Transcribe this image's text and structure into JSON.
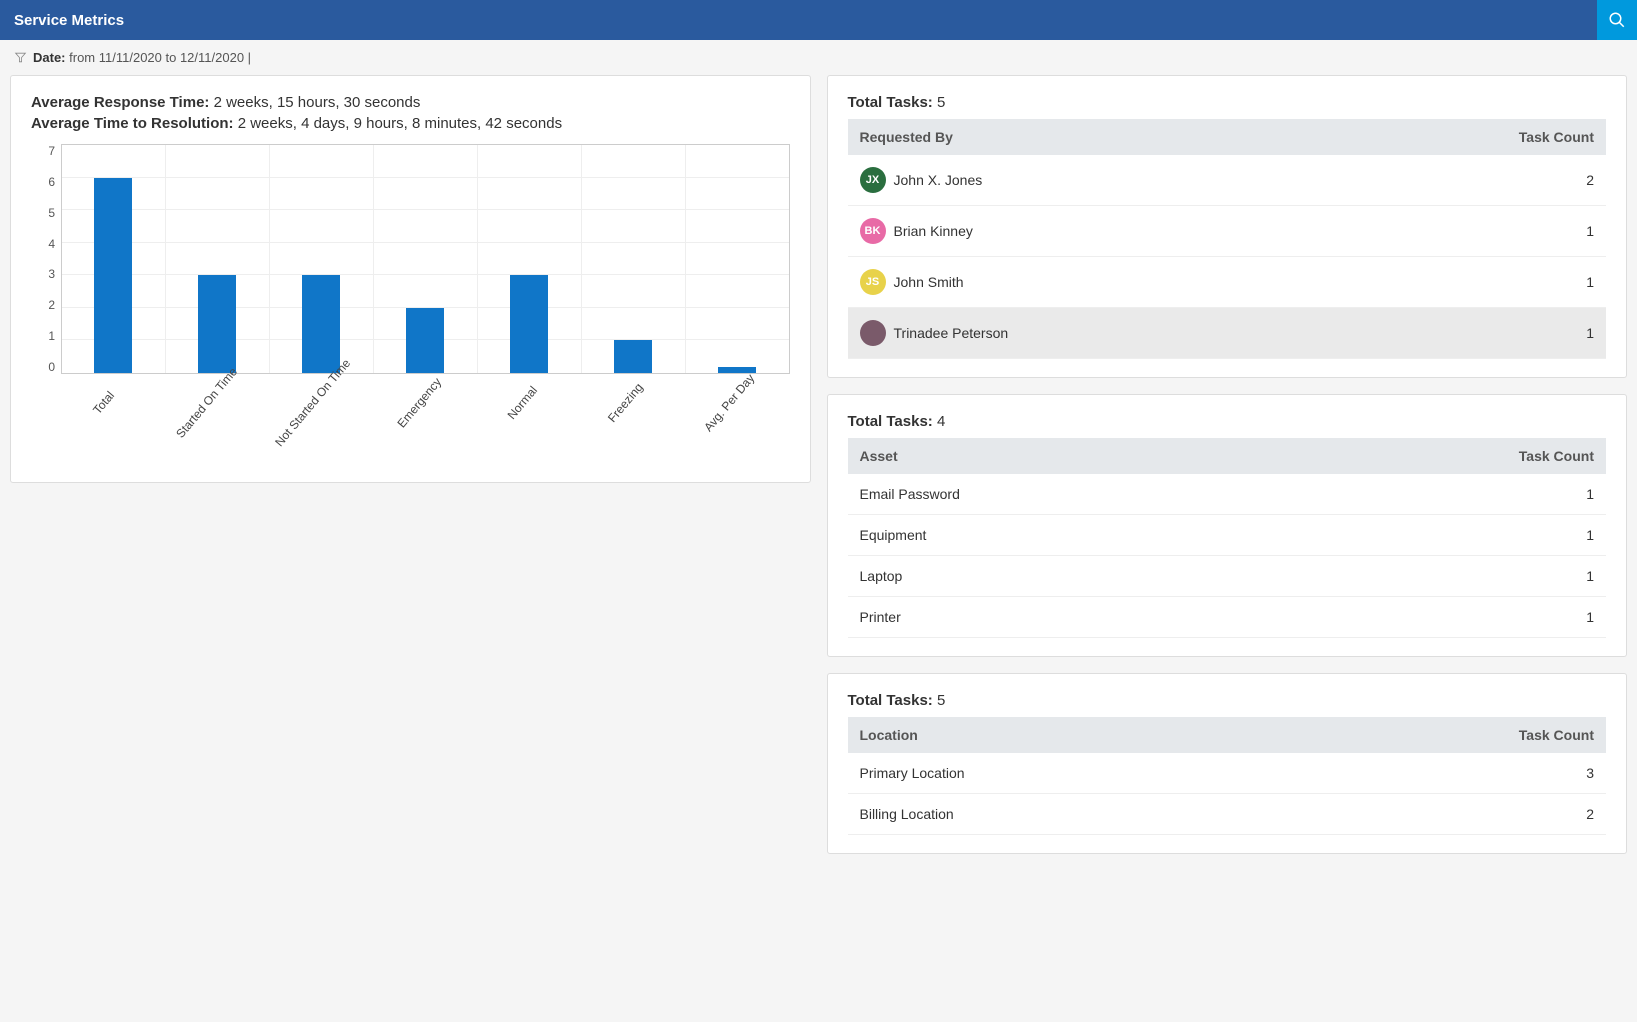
{
  "header": {
    "title": "Service Metrics"
  },
  "filter": {
    "label": "Date:",
    "value": "from 11/11/2020 to 12/11/2020 |"
  },
  "metrics": {
    "response_label": "Average Response Time:",
    "response_value": "2 weeks, 15 hours, 30 seconds",
    "resolution_label": "Average Time to Resolution:",
    "resolution_value": "2 weeks, 4 days, 9 hours, 8 minutes, 42 seconds"
  },
  "chart_data": {
    "type": "bar",
    "categories": [
      "Total",
      "Started On Time",
      "Not Started On Time",
      "Emergency",
      "Normal",
      "Freezing",
      "Avg. Per Day"
    ],
    "values": [
      6,
      3,
      3,
      2,
      3,
      1,
      0.2
    ],
    "ylim": [
      0,
      7
    ],
    "yticks": [
      0,
      1,
      2,
      3,
      4,
      5,
      6,
      7
    ],
    "bar_color": "#1076c8"
  },
  "tables": {
    "task_count_header": "Task Count",
    "requested": {
      "total_label": "Total Tasks:",
      "total_value": "5",
      "col1": "Requested By",
      "rows": [
        {
          "initials": "JX",
          "color": "#2a6e3f",
          "name": "John X. Jones",
          "count": "2"
        },
        {
          "initials": "BK",
          "color": "#e86aa6",
          "name": "Brian Kinney",
          "count": "1"
        },
        {
          "initials": "JS",
          "color": "#e8d24a",
          "name": "John Smith",
          "count": "1"
        },
        {
          "initials": "",
          "color": "#7a5a6a",
          "name": "Trinadee Peterson",
          "count": "1",
          "highlight": true,
          "img": true
        }
      ]
    },
    "asset": {
      "total_label": "Total Tasks:",
      "total_value": "4",
      "col1": "Asset",
      "rows": [
        {
          "name": "Email Password",
          "count": "1"
        },
        {
          "name": "Equipment",
          "count": "1"
        },
        {
          "name": "Laptop",
          "count": "1"
        },
        {
          "name": "Printer",
          "count": "1"
        }
      ]
    },
    "location": {
      "total_label": "Total Tasks:",
      "total_value": "5",
      "col1": "Location",
      "rows": [
        {
          "name": "Primary Location",
          "count": "3"
        },
        {
          "name": "Billing Location",
          "count": "2"
        }
      ]
    }
  }
}
